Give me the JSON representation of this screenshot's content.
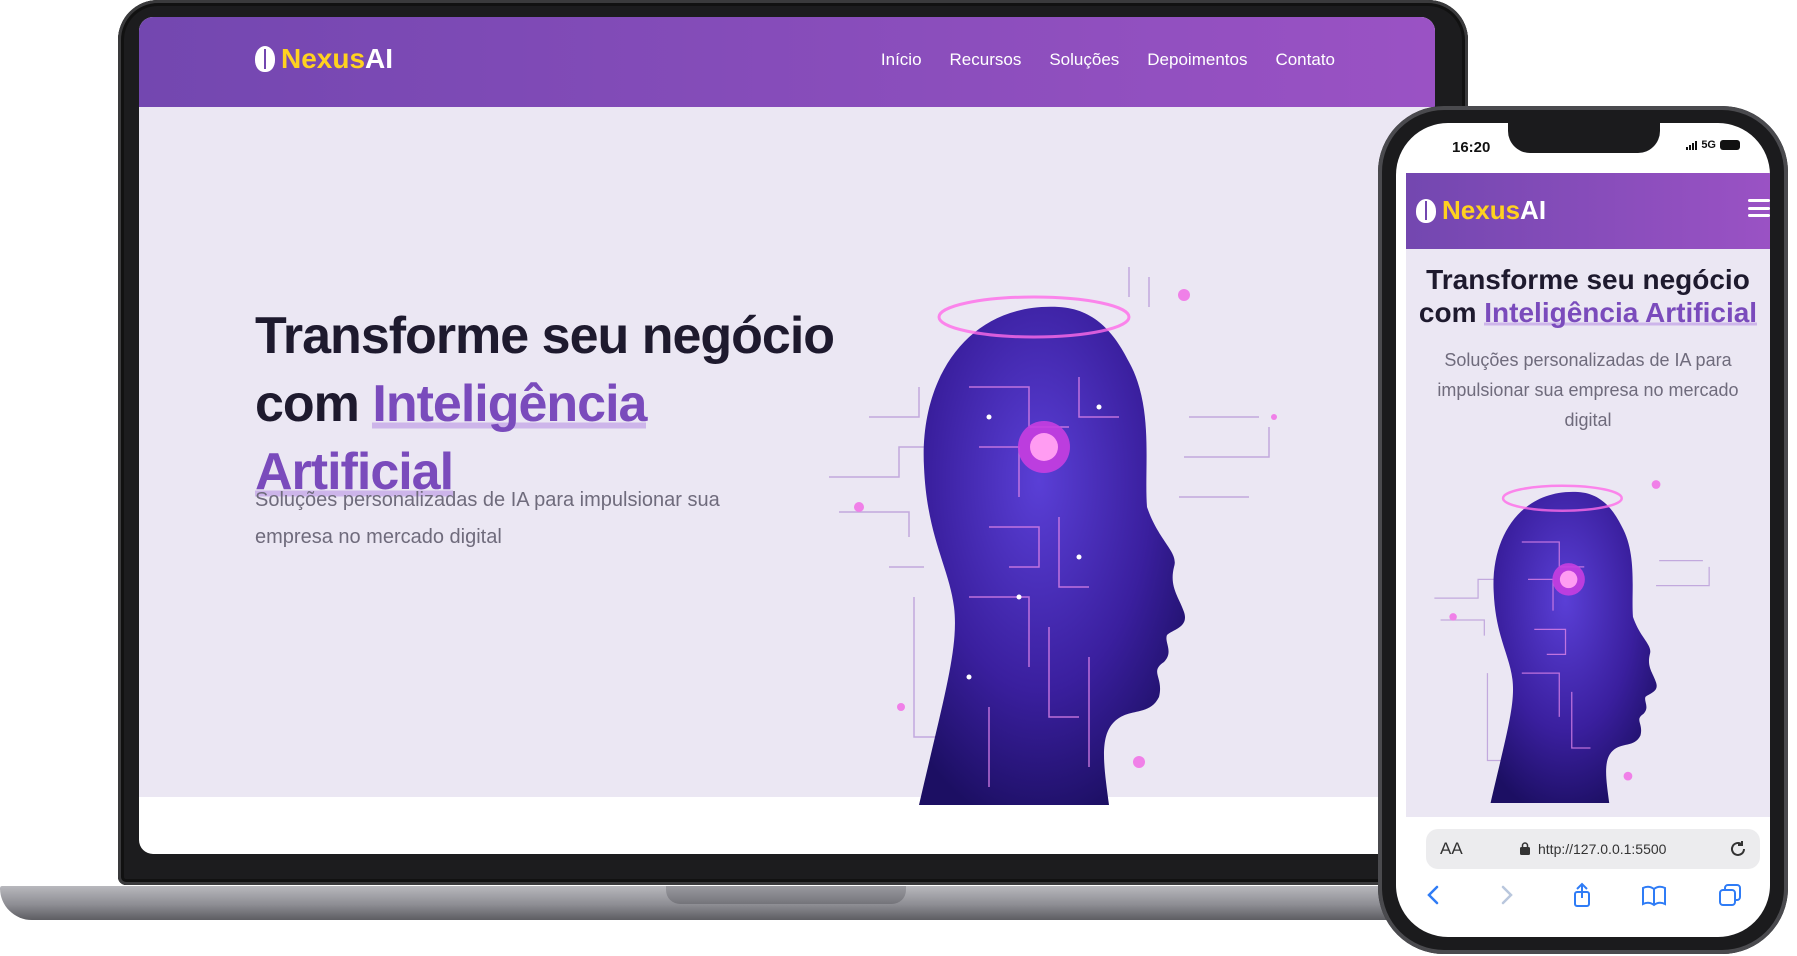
{
  "desktop": {
    "logo": {
      "nexus": "Nexus",
      "ai": "AI",
      "icon": "brain-icon"
    },
    "nav": [
      "Início",
      "Recursos",
      "Soluções",
      "Depoimentos",
      "Contato"
    ],
    "hero": {
      "title_line1": "Transforme seu negócio",
      "title_prefix": "com ",
      "title_highlight": "Inteligência Artificial",
      "subtitle": "Soluções personalizadas de IA para impulsionar sua empresa no mercado digital"
    }
  },
  "mobile": {
    "status": {
      "time": "16:20",
      "network": "5G"
    },
    "logo": {
      "nexus": "Nexus",
      "ai": "AI",
      "icon": "brain-icon"
    },
    "hero": {
      "title_line1": "Transforme seu negócio",
      "title_prefix": "com ",
      "title_highlight": "Inteligência Artificial",
      "subtitle": "Soluções personalizadas de IA para impulsionar sua empresa no mercado digital"
    },
    "browser": {
      "text_size_label": "AA",
      "url": "http://127.0.0.1:5500",
      "toolbar_icons": [
        "back-icon",
        "forward-icon",
        "share-icon",
        "bookmarks-icon",
        "tabs-icon"
      ]
    }
  },
  "colors": {
    "nav_gradient_start": "#7347b0",
    "nav_gradient_end": "#9a52c4",
    "logo_accent": "#ffd21f",
    "highlight": "#7a4bbc",
    "hero_bg": "#ebe7f3"
  }
}
